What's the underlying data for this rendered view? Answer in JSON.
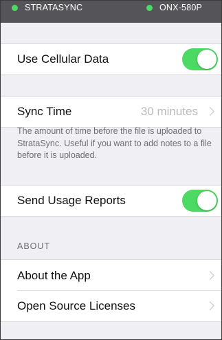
{
  "status_bar": {
    "left_label": "STRATASYNC",
    "right_label": "ONX-580P",
    "dot_color": "#4cd964",
    "background": "#555559"
  },
  "settings": {
    "cellular": {
      "label": "Use Cellular Data",
      "enabled": true
    },
    "sync_time": {
      "label": "Sync Time",
      "value": "30 minutes",
      "footer": "The amount of time before the file is uploaded to StrataSync. Useful if you want to add notes to a file before it is uploaded."
    },
    "usage_reports": {
      "label": "Send Usage Reports",
      "enabled": true
    }
  },
  "about_section": {
    "header": "ABOUT",
    "items": [
      {
        "label": "About the App"
      },
      {
        "label": "Open Source Licenses"
      }
    ]
  },
  "colors": {
    "toggle_on": "#4cd964",
    "background": "#efeff4",
    "chevron": "#c4c4c9"
  },
  "icons": [
    "status-dot-icon",
    "chevron-right-icon"
  ]
}
